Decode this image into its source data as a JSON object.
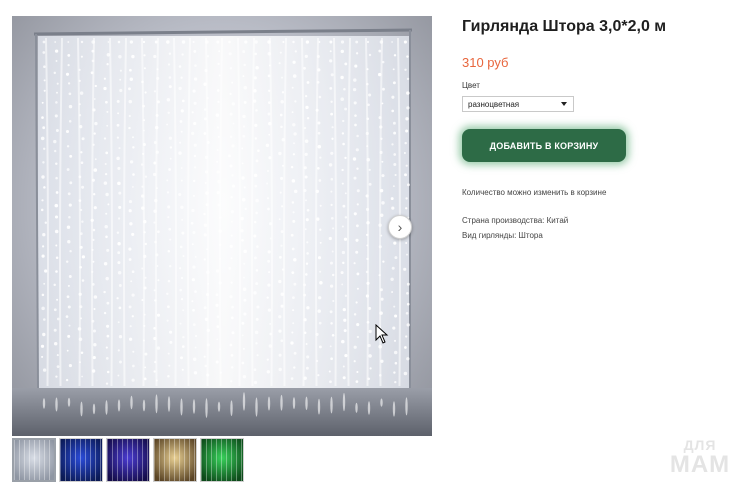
{
  "product": {
    "title": "Гирлянда Штора 3,0*2,0 м",
    "price": "310 руб",
    "color_label": "Цвет",
    "color_selected": "разноцветная",
    "add_to_cart_label": "ДОБАВИТЬ В КОРЗИНУ",
    "quantity_note": "Количество можно изменить в корзине",
    "specs": [
      {
        "text": "Страна производства: Китай"
      },
      {
        "text": "Вид гирлянды: Штора"
      }
    ]
  },
  "gallery": {
    "next_icon": "chevron-right-icon",
    "thumbnails": [
      {
        "name": "white",
        "colors": [
          "#d8dde6",
          "#8f96a3"
        ],
        "active": true
      },
      {
        "name": "blue",
        "colors": [
          "#2a4bd8",
          "#0b1a55"
        ],
        "active": false
      },
      {
        "name": "purple",
        "colors": [
          "#4a3bd0",
          "#150d4a"
        ],
        "active": false
      },
      {
        "name": "warm",
        "colors": [
          "#e8cf92",
          "#5a4425"
        ],
        "active": false
      },
      {
        "name": "green",
        "colors": [
          "#37d05a",
          "#0d4a1a"
        ],
        "active": false
      }
    ]
  },
  "logo": {
    "line1": "ДЛЯ",
    "line2": "МАМ"
  },
  "colors": {
    "accent_price": "#e8663d",
    "cart_button": "#2d6b46"
  }
}
